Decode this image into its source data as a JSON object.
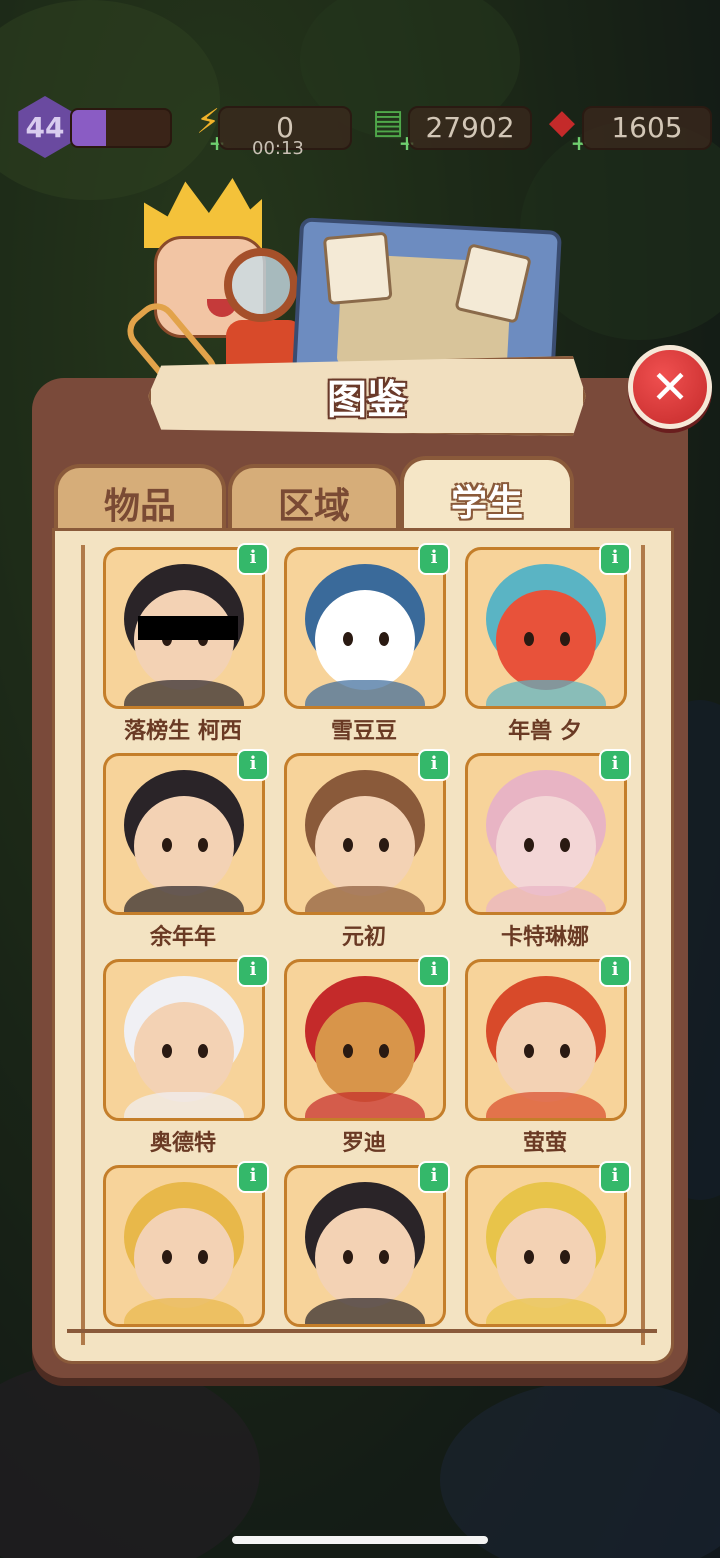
{
  "hud": {
    "level": "44",
    "xp_progress": 0.35,
    "energy": "0",
    "energy_timer": "00:13",
    "cash": "27902",
    "gems": "1605",
    "icons": {
      "energy": "lightning-icon",
      "cash": "cash-stack-icon",
      "gems": "ruby-icon"
    }
  },
  "header": {
    "title": "图鉴",
    "close_icon": "close-icon"
  },
  "tabs": [
    {
      "label": "物品",
      "active": false
    },
    {
      "label": "区域",
      "active": false
    },
    {
      "label": "学生",
      "active": true
    }
  ],
  "students": [
    {
      "name": "落榜生 柯西"
    },
    {
      "name": "雪豆豆"
    },
    {
      "name": "年兽 夕"
    },
    {
      "name": "余年年"
    },
    {
      "name": "元初"
    },
    {
      "name": "卡特琳娜"
    },
    {
      "name": "奥德特"
    },
    {
      "name": "罗迪"
    },
    {
      "name": "萤萤"
    },
    {
      "name": ""
    },
    {
      "name": ""
    },
    {
      "name": ""
    }
  ],
  "info_icon_label": "i",
  "colors": {
    "panel": "#7a4a3a",
    "content_bg": "#f3e3c2",
    "card_border": "#c47e2a",
    "info_green": "#34b86a",
    "close_red": "#d83a3a"
  }
}
